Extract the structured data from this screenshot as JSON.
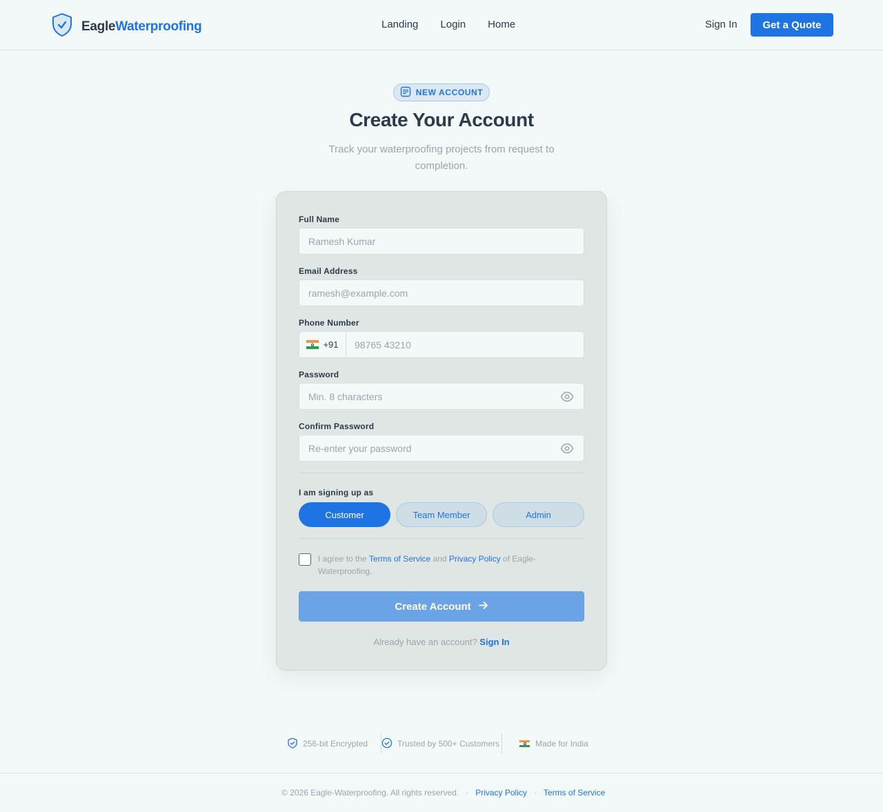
{
  "header": {
    "brand_a": "Eagle",
    "brand_b": "Waterproofing",
    "nav": [
      "Landing",
      "Login",
      "Home"
    ],
    "signin": "Sign In",
    "quote": "Get a Quote"
  },
  "hero": {
    "badge": "NEW ACCOUNT",
    "title": "Create Your Account",
    "subtitle": "Track your waterproofing projects from request to completion."
  },
  "form": {
    "full_name": {
      "label": "Full Name",
      "placeholder": "Ramesh Kumar"
    },
    "email": {
      "label": "Email Address",
      "placeholder": "ramesh@example.com"
    },
    "phone": {
      "label": "Phone Number",
      "code": "+91",
      "placeholder": "98765 43210"
    },
    "password": {
      "label": "Password",
      "placeholder": "Min. 8 characters"
    },
    "confirm": {
      "label": "Confirm Password",
      "placeholder": "Re-enter your password"
    },
    "role_label": "I am signing up as",
    "roles": [
      "Customer",
      "Team Member",
      "Admin"
    ],
    "selected_role": "Customer",
    "terms_pre": "I agree to the ",
    "terms_tos": "Terms of Service",
    "terms_and": " and ",
    "terms_pp": "Privacy Policy",
    "terms_post": " of Eagle-Waterproofing.",
    "submit": "Create Account",
    "already": "Already have an account?",
    "signin": "Sign In"
  },
  "trust": [
    "256-bit Encrypted",
    "Trusted by 500+ Customers",
    "Made for India"
  ],
  "footer": {
    "copyright": "© 2026 Eagle-Waterproofing. All rights reserved.",
    "privacy": "Privacy Policy",
    "terms": "Terms of Service",
    "sep": "·"
  },
  "colors": {
    "accent": "#1f74e3",
    "background": "#f3f8f8",
    "card": "#dfe6e3"
  }
}
